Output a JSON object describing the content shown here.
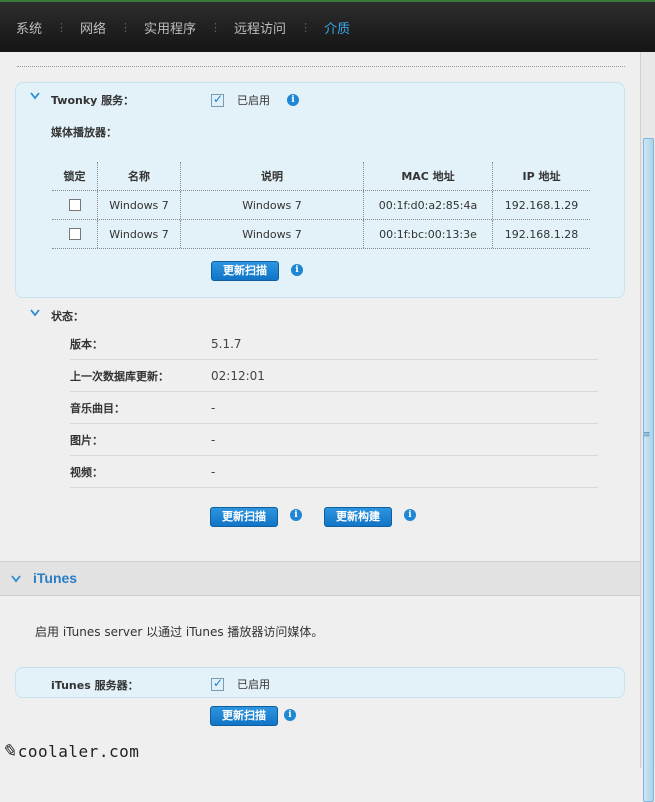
{
  "nav": {
    "tabs": [
      "系统",
      "网络",
      "实用程序",
      "远程访问",
      "介质"
    ],
    "active_index": 4
  },
  "twonky": {
    "service_label": "Twonky 服务：",
    "enabled_label": "已启用",
    "enabled": true,
    "players_label": "媒体播放器：",
    "table": {
      "headers": [
        "锁定",
        "名称",
        "说明",
        "MAC 地址",
        "IP 地址"
      ],
      "rows": [
        {
          "locked": false,
          "name": "Windows 7",
          "desc": "Windows 7",
          "mac": "00:1f:d0:a2:85:4a",
          "ip": "192.168.1.29"
        },
        {
          "locked": false,
          "name": "Windows 7",
          "desc": "Windows 7",
          "mac": "00:1f:bc:00:13:3e",
          "ip": "192.168.1.28"
        }
      ]
    },
    "rescan_label": "更新扫描"
  },
  "status": {
    "title": "状态：",
    "rows": [
      {
        "key": "版本：",
        "value": "5.1.7"
      },
      {
        "key": "上一次数据库更新：",
        "value": "02:12:01"
      },
      {
        "key": "音乐曲目：",
        "value": "-"
      },
      {
        "key": "图片：",
        "value": "-"
      },
      {
        "key": "视频：",
        "value": "-"
      }
    ],
    "rescan_label": "更新扫描",
    "rebuild_label": "更新构建"
  },
  "itunes": {
    "title": "iTunes",
    "description": "启用 iTunes server 以通过 iTunes 播放器访问媒体。",
    "server_label": "iTunes 服务器：",
    "enabled_label": "已启用",
    "enabled": true,
    "rescan_label": "更新扫描"
  },
  "watermark": {
    "text": "coolaler.com"
  },
  "colors": {
    "accent": "#2a8ed0",
    "button": "#1a80cf",
    "panel": "#e3f2f8"
  }
}
